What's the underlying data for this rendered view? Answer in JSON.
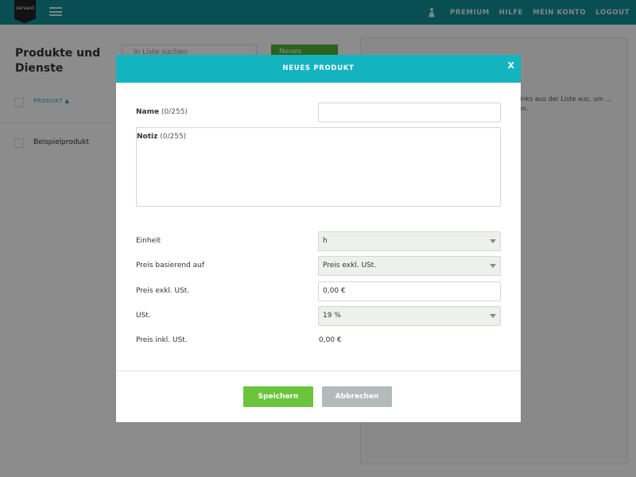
{
  "header": {
    "logo_text": "zervant",
    "nav": [
      "PREMIUM",
      "HILFE",
      "MEIN KONTO",
      "LOGOUT"
    ]
  },
  "background": {
    "page_title": "Produkte und Dienste",
    "search_placeholder": "In Liste suchen",
    "new_button": "Neues",
    "column_header": "PRODUKT ▲",
    "rows": [
      "Beispielprodukt"
    ],
    "hint": "links aus der Liste aus, um ... en."
  },
  "modal": {
    "title": "NEUES PRODUKT",
    "close": "X",
    "fields": {
      "name": {
        "label": "Name",
        "counter": "(0/255)",
        "value": ""
      },
      "notiz": {
        "label": "Notiz",
        "counter": "(0/255)",
        "value": ""
      },
      "einheit": {
        "label": "Einheit",
        "value": "h"
      },
      "preis_basis": {
        "label": "Preis basierend auf",
        "value": "Preis exkl. USt."
      },
      "preis_exkl": {
        "label": "Preis exkl. USt.",
        "value": "0,00 €"
      },
      "ust": {
        "label": "USt.",
        "value": "19 %"
      },
      "preis_inkl": {
        "label": "Preis inkl. USt.",
        "value": "0,00 €"
      }
    },
    "buttons": {
      "save": "Speichern",
      "cancel": "Abbrechen"
    }
  },
  "colors": {
    "topbar": "#0f8f96",
    "modal_header": "#13b4c0",
    "save": "#6ac53c",
    "cancel": "#b3baba"
  }
}
